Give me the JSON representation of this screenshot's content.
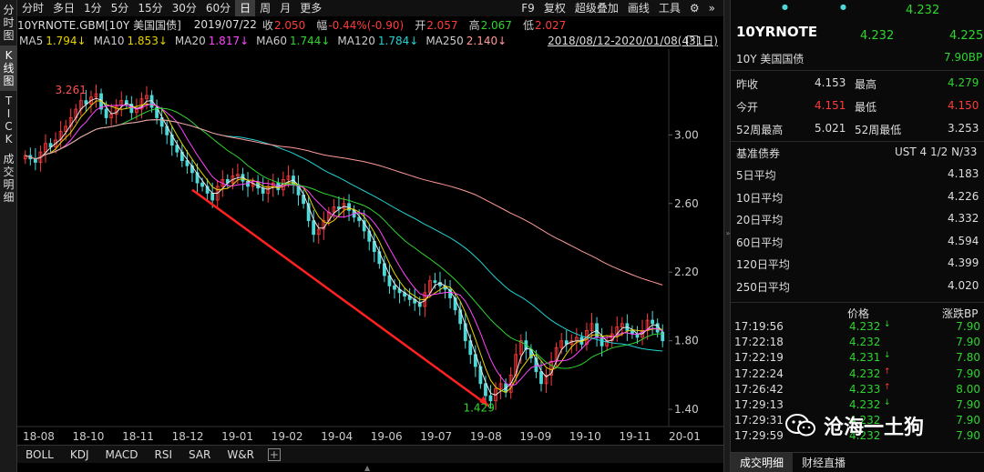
{
  "side_tabs": [
    {
      "label": "分时图",
      "chars": [
        "分",
        "时",
        "图"
      ]
    },
    {
      "label": "K线图",
      "chars": [
        "K",
        "线",
        "图"
      ]
    },
    {
      "label": "TICK",
      "chars": [
        "T",
        "I",
        "C",
        "K"
      ]
    },
    {
      "label": "成交明细",
      "chars": [
        "成",
        "交",
        "明",
        "细"
      ]
    }
  ],
  "toolbar": {
    "periods": [
      "分时",
      "多日",
      "1分",
      "5分",
      "15分",
      "30分",
      "60分",
      "日",
      "周",
      "月",
      "更多"
    ],
    "active_period": "日",
    "right": [
      "F9",
      "复权",
      "超级叠加",
      "画线",
      "工具"
    ],
    "more_label": "»"
  },
  "info": {
    "symbol": "10YRNOTE.GBM[10Y 美国国债]",
    "date": "2019/07/22",
    "close_label": "收",
    "close": "2.050",
    "change_label": "幅",
    "change": "-0.44%(-0.90)",
    "open_label": "开",
    "open": "2.057",
    "high_label": "高",
    "high": "2.067",
    "low_label": "低",
    "low": "2.027"
  },
  "ma": [
    {
      "label": "MA5",
      "value": "1.794↓",
      "color": "#e8d300"
    },
    {
      "label": "MA10",
      "value": "1.853↓",
      "color": "#e8d300"
    },
    {
      "label": "MA20",
      "value": "1.817↓",
      "color": "#ff44ff"
    },
    {
      "label": "MA60",
      "value": "1.744↓",
      "color": "#2fd42f"
    },
    {
      "label": "MA120",
      "value": "1.784↓",
      "color": "#22d3d3"
    },
    {
      "label": "MA250",
      "value": "2.140↓",
      "color": "#ff9999"
    }
  ],
  "date_range": "2018/08/12-2020/01/08(431日)",
  "chart_data": {
    "type": "candlestick",
    "ylim": [
      1.3,
      3.5
    ],
    "y_ticks": [
      3.0,
      2.6,
      2.2,
      1.8,
      1.4
    ],
    "y_tick_labels": [
      "3.00",
      "2.60",
      "2.20",
      "1.80",
      "1.40"
    ],
    "x_tick_labels": [
      "18-08",
      "18-10",
      "18-11",
      "18-12",
      "19-01",
      "19-02",
      "19-04",
      "19-06",
      "19-07",
      "19-08",
      "19-09",
      "19-10",
      "19-11",
      "20-01"
    ],
    "annotations": [
      {
        "text": "3.261",
        "value": 3.261,
        "kind": "max"
      },
      {
        "text": "1.429",
        "value": 1.429,
        "kind": "min"
      }
    ],
    "price_path": [
      2.88,
      2.86,
      2.84,
      2.9,
      2.95,
      2.93,
      2.97,
      3.02,
      3.05,
      3.1,
      3.15,
      3.2,
      3.18,
      3.22,
      3.24,
      3.15,
      3.1,
      3.12,
      3.17,
      3.2,
      3.18,
      3.13,
      3.15,
      3.21,
      3.23,
      3.16,
      3.1,
      3.05,
      3.0,
      2.94,
      2.9,
      2.85,
      2.82,
      2.78,
      2.72,
      2.7,
      2.66,
      2.62,
      2.7,
      2.74,
      2.72,
      2.76,
      2.77,
      2.73,
      2.7,
      2.72,
      2.69,
      2.66,
      2.7,
      2.72,
      2.68,
      2.74,
      2.76,
      2.71,
      2.65,
      2.6,
      2.5,
      2.42,
      2.45,
      2.5,
      2.55,
      2.58,
      2.57,
      2.6,
      2.56,
      2.52,
      2.5,
      2.44,
      2.38,
      2.32,
      2.25,
      2.18,
      2.12,
      2.1,
      2.08,
      2.06,
      2.04,
      2.02,
      2.0,
      2.08,
      2.15,
      2.14,
      2.12,
      2.1,
      2.05,
      1.98,
      1.9,
      1.8,
      1.72,
      1.65,
      1.55,
      1.48,
      1.45,
      1.52,
      1.55,
      1.5,
      1.6,
      1.72,
      1.8,
      1.75,
      1.7,
      1.62,
      1.55,
      1.6,
      1.68,
      1.76,
      1.8,
      1.78,
      1.8,
      1.82,
      1.78,
      1.86,
      1.9,
      1.82,
      1.77,
      1.8,
      1.84,
      1.88,
      1.9,
      1.86,
      1.84,
      1.82,
      1.86,
      1.92,
      1.9,
      1.85,
      1.8
    ]
  },
  "panel": {
    "top_value": "4.232",
    "title": "10YRNOTE",
    "price": "4.232",
    "price2": "4.225",
    "name": "10Y 美国国债",
    "bp": "7.90BP",
    "rows": [
      {
        "l1": "昨收",
        "v1": "4.153",
        "c1": "white",
        "l2": "最高",
        "v2": "4.279",
        "c2": "green"
      },
      {
        "l1": "今开",
        "v1": "4.151",
        "c1": "red",
        "l2": "最低",
        "v2": "4.150",
        "c2": "red"
      },
      {
        "l1": "52周最高",
        "v1": "5.021",
        "c1": "white",
        "l2": "52周最低",
        "v2": "3.253",
        "c2": "white"
      }
    ],
    "bench_label": "基准债券",
    "bench_value": "UST 4 1/2 N/33",
    "averages": [
      {
        "label": "5日平均",
        "value": "4.183"
      },
      {
        "label": "10日平均",
        "value": "4.226"
      },
      {
        "label": "20日平均",
        "value": "4.332"
      },
      {
        "label": "60日平均",
        "value": "4.594"
      },
      {
        "label": "120日平均",
        "value": "4.399"
      },
      {
        "label": "250日平均",
        "value": "4.020"
      }
    ],
    "tick_header": {
      "price": "价格",
      "bp": "涨跌BP"
    },
    "ticks": [
      {
        "time": "17:19:56",
        "price": "4.232",
        "arrow": "↓",
        "arrow_color": "green",
        "bp": "7.90"
      },
      {
        "time": "17:22:18",
        "price": "4.232",
        "arrow": "",
        "arrow_color": "green",
        "bp": "7.90"
      },
      {
        "time": "17:22:19",
        "price": "4.231",
        "arrow": "↓",
        "arrow_color": "green",
        "bp": "7.80"
      },
      {
        "time": "17:22:24",
        "price": "4.232",
        "arrow": "↑",
        "arrow_color": "red",
        "bp": "7.90"
      },
      {
        "time": "17:26:42",
        "price": "4.233",
        "arrow": "↑",
        "arrow_color": "red",
        "bp": "8.00"
      },
      {
        "time": "17:29:13",
        "price": "4.232",
        "arrow": "↓",
        "arrow_color": "green",
        "bp": "7.90"
      },
      {
        "time": "17:29:31",
        "price": "4.232",
        "arrow": "",
        "arrow_color": "green",
        "bp": "7.90"
      },
      {
        "time": "17:29:59",
        "price": "4.232",
        "arrow": "",
        "arrow_color": "green",
        "bp": "7.90"
      }
    ],
    "tabs": [
      "成交明细",
      "财经直播"
    ],
    "watermark": "沧海一土狗"
  },
  "indicators": [
    "BOLL",
    "KDJ",
    "MACD",
    "RSI",
    "SAR",
    "W&R"
  ],
  "indicator_plus": "+",
  "colors": {
    "up": "#ff3b3b",
    "down": "#2fd42f",
    "trend": "#ff2020",
    "grid": "#2a2a2a"
  }
}
